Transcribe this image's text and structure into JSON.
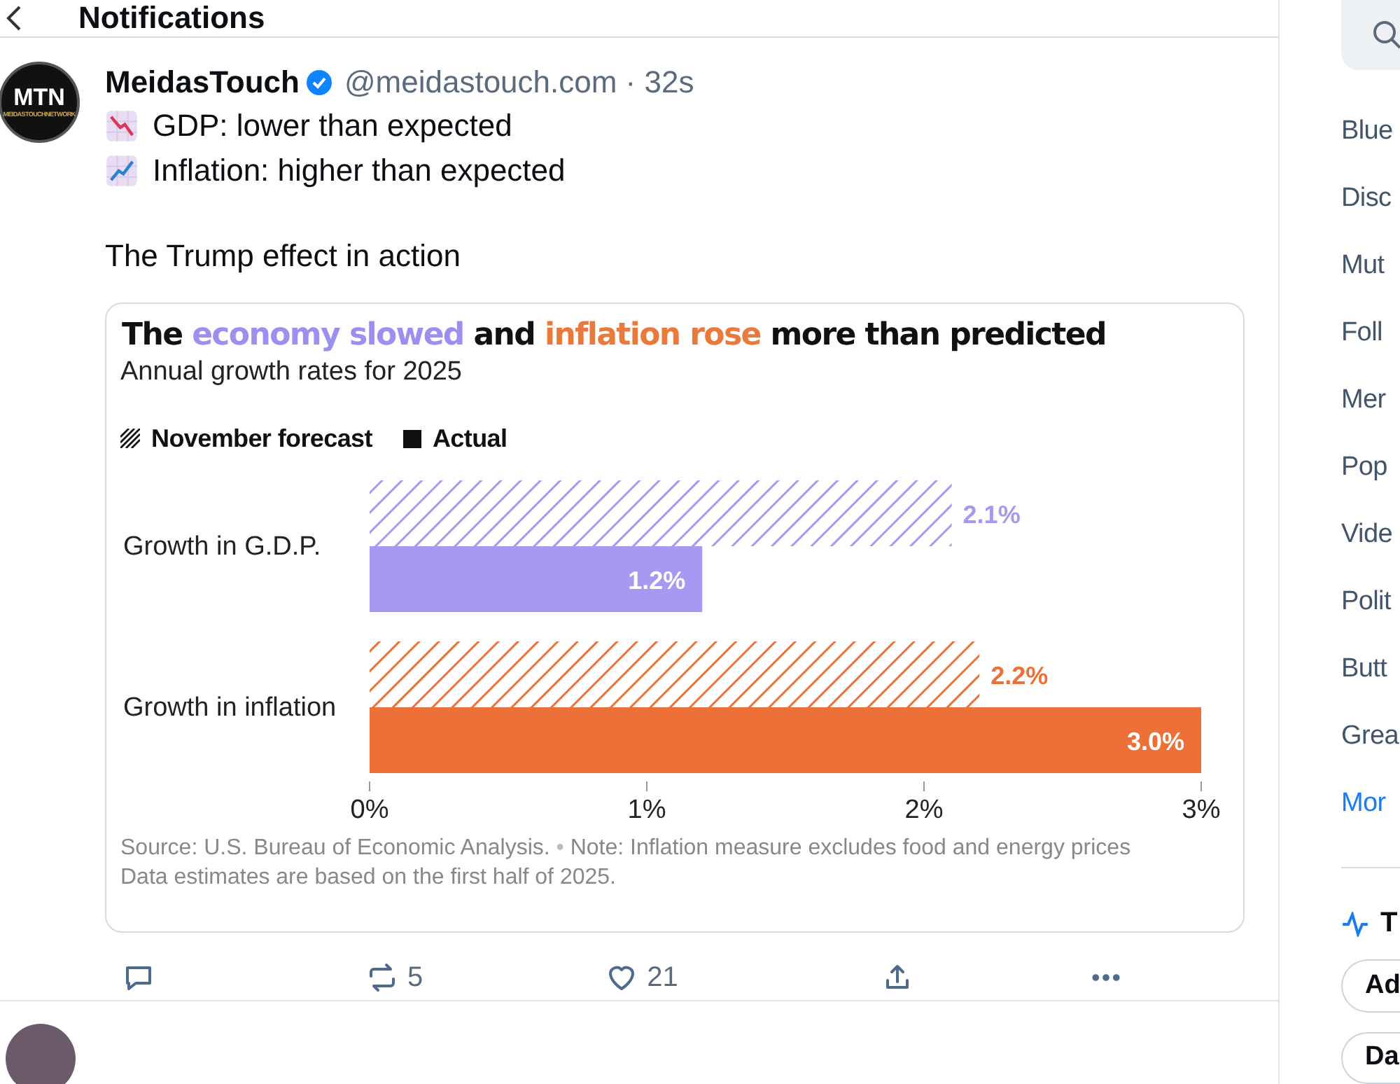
{
  "header": {
    "title": "Notifications"
  },
  "post": {
    "avatar_text": "MTN",
    "avatar_subtext": "MEIDASTOUCHNETWORK",
    "author": "MeidasTouch",
    "verified": true,
    "handle": "@meidastouch.com · 32s",
    "lines": [
      {
        "kind": "down",
        "text": "GDP: lower than expected"
      },
      {
        "kind": "up",
        "text": "Inflation: higher than expected"
      }
    ],
    "text": "The Trump effect in action",
    "card": {
      "title_segments": [
        {
          "text": "The "
        },
        {
          "text": "economy slowed",
          "color": "#9b8ff0"
        },
        {
          "text": " and "
        },
        {
          "text": "inflation rose",
          "color": "#ea7a3c"
        },
        {
          "text": " more than predicted"
        }
      ],
      "subtitle": "Annual growth rates for 2025",
      "legend": [
        {
          "kind": "hatched"
        },
        {
          "kind": "solid"
        }
      ],
      "chart_data": {
        "type": "bar",
        "orientation": "horizontal",
        "categories": [
          "Growth in G.D.P.",
          "Growth in inflation"
        ],
        "series": [
          {
            "name": "November forecast",
            "colors": [
              "#a599f2",
              "#ec7038"
            ],
            "values": [
              2.1,
              2.2
            ],
            "value_labels": [
              "2.1%",
              "2.2%"
            ]
          },
          {
            "name": "Actual",
            "colors": [
              "#a599f2",
              "#ec7038"
            ],
            "values": [
              1.2,
              3.0
            ],
            "value_labels": [
              "1.2%",
              "3.0%"
            ]
          }
        ],
        "xlim": [
          0,
          3
        ],
        "xticks": [
          {
            "value": 0,
            "label": "0%"
          },
          {
            "value": 1,
            "label": "1%"
          },
          {
            "value": 2,
            "label": "2%"
          },
          {
            "value": 3,
            "label": "3%"
          }
        ]
      },
      "source": "Source: U.S. Bureau of Economic Analysis.",
      "separator": "•",
      "note": "Note: Inflation measure excludes food and energy prices",
      "note2": "Data estimates are based on the first half of 2025."
    },
    "actions": [
      {
        "kind": "reply"
      },
      {
        "kind": "repost",
        "count": "5"
      },
      {
        "kind": "like",
        "count": "21"
      },
      {
        "kind": "share"
      },
      {
        "kind": "more"
      }
    ]
  },
  "sidebar": {
    "items": [
      {
        "label": "Blue",
        "link": false
      },
      {
        "label": "Disc",
        "link": false
      },
      {
        "label": "Mut",
        "link": false
      },
      {
        "label": "Foll",
        "link": false
      },
      {
        "label": "Mer",
        "link": false
      },
      {
        "label": "Pop",
        "link": false
      },
      {
        "label": "Vide",
        "link": false
      },
      {
        "label": "Polit",
        "link": false
      },
      {
        "label": "Butt",
        "link": false
      },
      {
        "label": "Grea",
        "link": false
      },
      {
        "label": "Mor",
        "link": true
      }
    ],
    "trending_title": "T",
    "pills": [
      "Ad",
      "Da"
    ]
  }
}
